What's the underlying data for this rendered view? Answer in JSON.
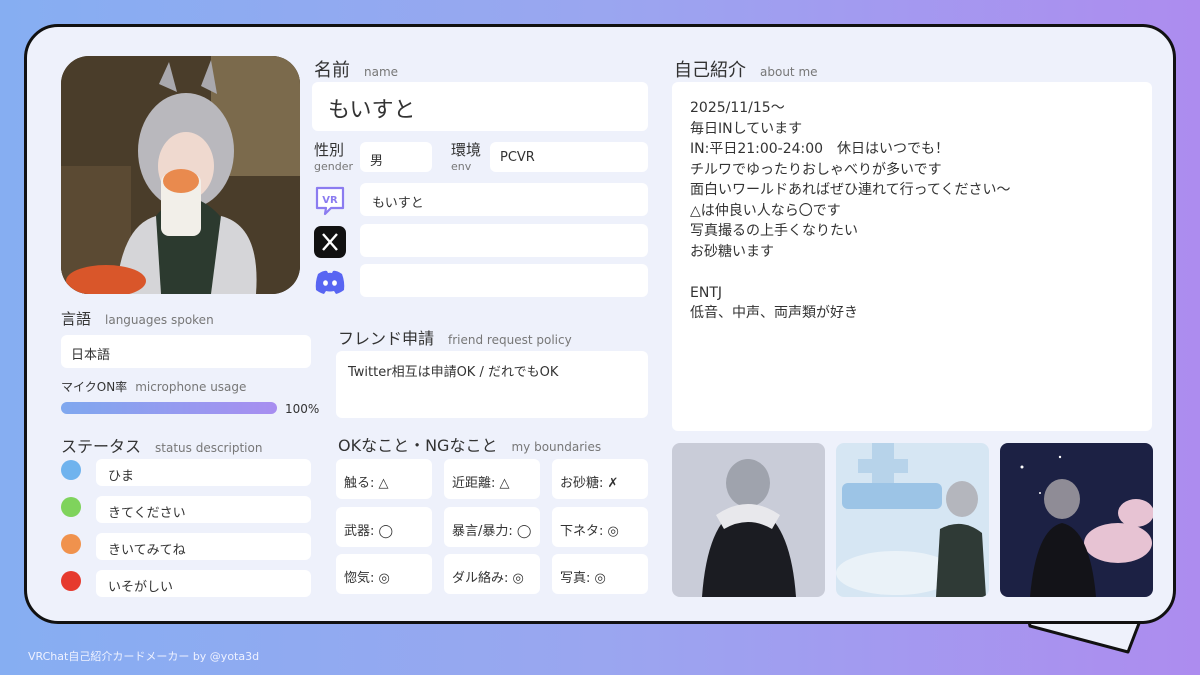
{
  "name": {
    "label_ja": "名前",
    "label_en": "name",
    "value": "もいすと"
  },
  "gender": {
    "label_ja": "性別",
    "label_en": "gender",
    "value": "男"
  },
  "env": {
    "label_ja": "環境",
    "label_en": "env",
    "value": "PCVR"
  },
  "socials": [
    {
      "icon": "vrchat-icon",
      "value": "もいすと"
    },
    {
      "icon": "x-icon",
      "value": ""
    },
    {
      "icon": "discord-icon",
      "value": ""
    }
  ],
  "languages": {
    "label_ja": "言語",
    "label_en": "languages spoken",
    "value": "日本語"
  },
  "mic": {
    "label_ja": "マイクON率",
    "label_en": "microphone usage",
    "value": "100%",
    "level": 1.0
  },
  "status": {
    "label_ja": "ステータス",
    "label_en": "status description",
    "items": [
      {
        "color": "#6fb3ee",
        "text": "ひま"
      },
      {
        "color": "#7fd35c",
        "text": "きてください"
      },
      {
        "color": "#f0924d",
        "text": "きいてみてね"
      },
      {
        "color": "#e63a2e",
        "text": "いそがしい"
      }
    ]
  },
  "friend": {
    "label_ja": "フレンド申請",
    "label_en": "friend request policy",
    "value": "Twitter相互は申請OK / だれでもOK"
  },
  "boundaries": {
    "label_ja": "OKなこと・NGなこと",
    "label_en": "my boundaries",
    "items": [
      "触る: △",
      "近距離: △",
      "お砂糖: ✗",
      "武器: ◯",
      "暴言/暴力: ◯",
      "下ネタ: ◎",
      "惚気: ◎",
      "ダル絡み: ◎",
      "写真: ◎"
    ]
  },
  "about": {
    "label_ja": "自己紹介",
    "label_en": "about me",
    "text": "2025/11/15〜\n毎日INしています\nIN:平日21:00-24:00　休日はいつでも！\nチルワでゆったりおしゃべりが多いです\n面白いワールドあればぜひ連れて行ってください〜\n△は仲良い人なら〇です\n写真撮るの上手くなりたい\nお砂糖います\n\nENTJ\n低音、中声、両声類が好き"
  },
  "footer": "VRChat自己紹介カードメーカー by @yota3d",
  "colors": {
    "accent_start": "#86aef2",
    "accent_end": "#ad8cef",
    "card_bg": "#eef1fb"
  }
}
